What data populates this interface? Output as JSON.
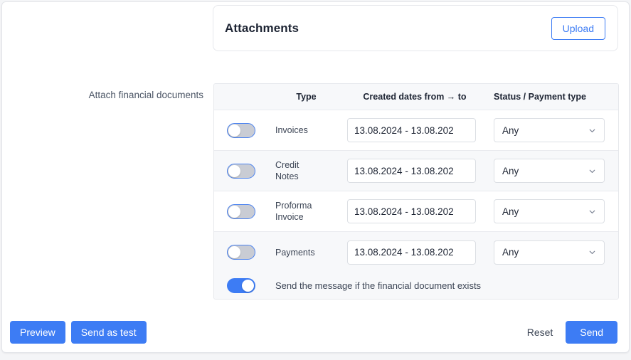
{
  "attachments_card": {
    "title": "Attachments",
    "upload_label": "Upload"
  },
  "form": {
    "field_label": "Attach financial documents"
  },
  "table": {
    "headers": {
      "toggle": "",
      "type": "Type",
      "dates": "Created dates from → to",
      "status": "Status / Payment type"
    },
    "rows": [
      {
        "type": "Invoices",
        "enabled": false,
        "dates": "13.08.2024 - 13.08.202",
        "status": "Any"
      },
      {
        "type": "Credit Notes",
        "enabled": false,
        "dates": "13.08.2024 - 13.08.202",
        "status": "Any"
      },
      {
        "type": "Proforma Invoice",
        "enabled": false,
        "dates": "13.08.2024 - 13.08.202",
        "status": "Any"
      },
      {
        "type": "Payments",
        "enabled": false,
        "dates": "13.08.2024 - 13.08.202",
        "status": "Any"
      }
    ],
    "footer": {
      "enabled": true,
      "label": "Send the message if the financial document exists"
    },
    "status_options": [
      "Any"
    ]
  },
  "actions": {
    "preview": "Preview",
    "send_as_test": "Send as test",
    "reset": "Reset",
    "send": "Send"
  },
  "colors": {
    "accent": "#3d7cf4",
    "text": "#1d2433",
    "muted": "#4b5565",
    "row_alt": "#f7f8fa",
    "border": "#e6e8ec",
    "toggle_off": "#c9ccd4"
  },
  "icons": {
    "chevron": "chevron-down-icon"
  }
}
